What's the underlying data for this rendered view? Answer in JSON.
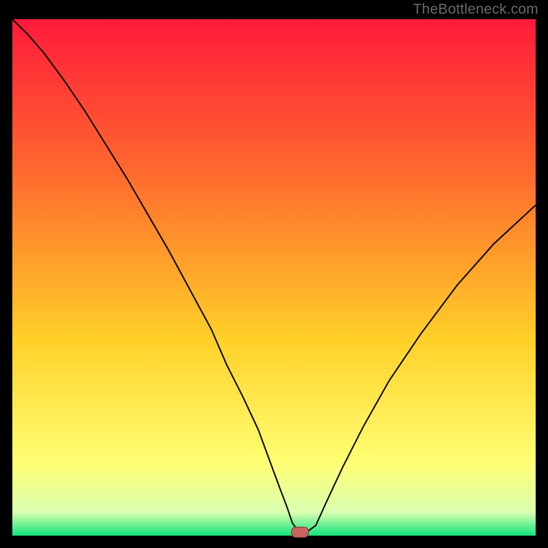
{
  "watermark": "TheBottleneck.com",
  "colors": {
    "background": "#000000",
    "grad_top": "#ff1a3a",
    "grad_q1": "#ff6a2e",
    "grad_mid": "#ffd028",
    "grad_q3": "#ffff74",
    "grad_near_bottom": "#d9ffb0",
    "grad_bottom": "#10e37a",
    "curve": "#000000",
    "marker_fill": "#c9635f",
    "marker_stroke": "#7a3a38",
    "watermark": "#6a6a6a"
  },
  "chart_data": {
    "type": "line",
    "title": "",
    "xlabel": "",
    "ylabel": "",
    "xlim": [
      0,
      100
    ],
    "ylim": [
      0,
      100
    ],
    "series": [
      {
        "name": "bottleneck-curve",
        "x": [
          0,
          3,
          6,
          10,
          14,
          18,
          22,
          26,
          30,
          34,
          38,
          41,
          44,
          47,
          49,
          51,
          52.5,
          53.5,
          54.5,
          56,
          58,
          60,
          63,
          67,
          72,
          78,
          85,
          92,
          100
        ],
        "values": [
          100,
          97,
          93.5,
          88,
          82,
          75.5,
          69,
          62,
          55,
          47.5,
          40,
          33,
          27,
          20.5,
          15,
          9.5,
          5.5,
          2.5,
          1,
          0.5,
          2,
          6.5,
          13,
          21,
          30,
          39,
          48.5,
          56.5,
          64
        ]
      }
    ],
    "flat_minimum": {
      "x_start": 53.5,
      "x_end": 56.5,
      "y": 0.5
    },
    "marker": {
      "x": 55,
      "y": 0.7
    }
  }
}
